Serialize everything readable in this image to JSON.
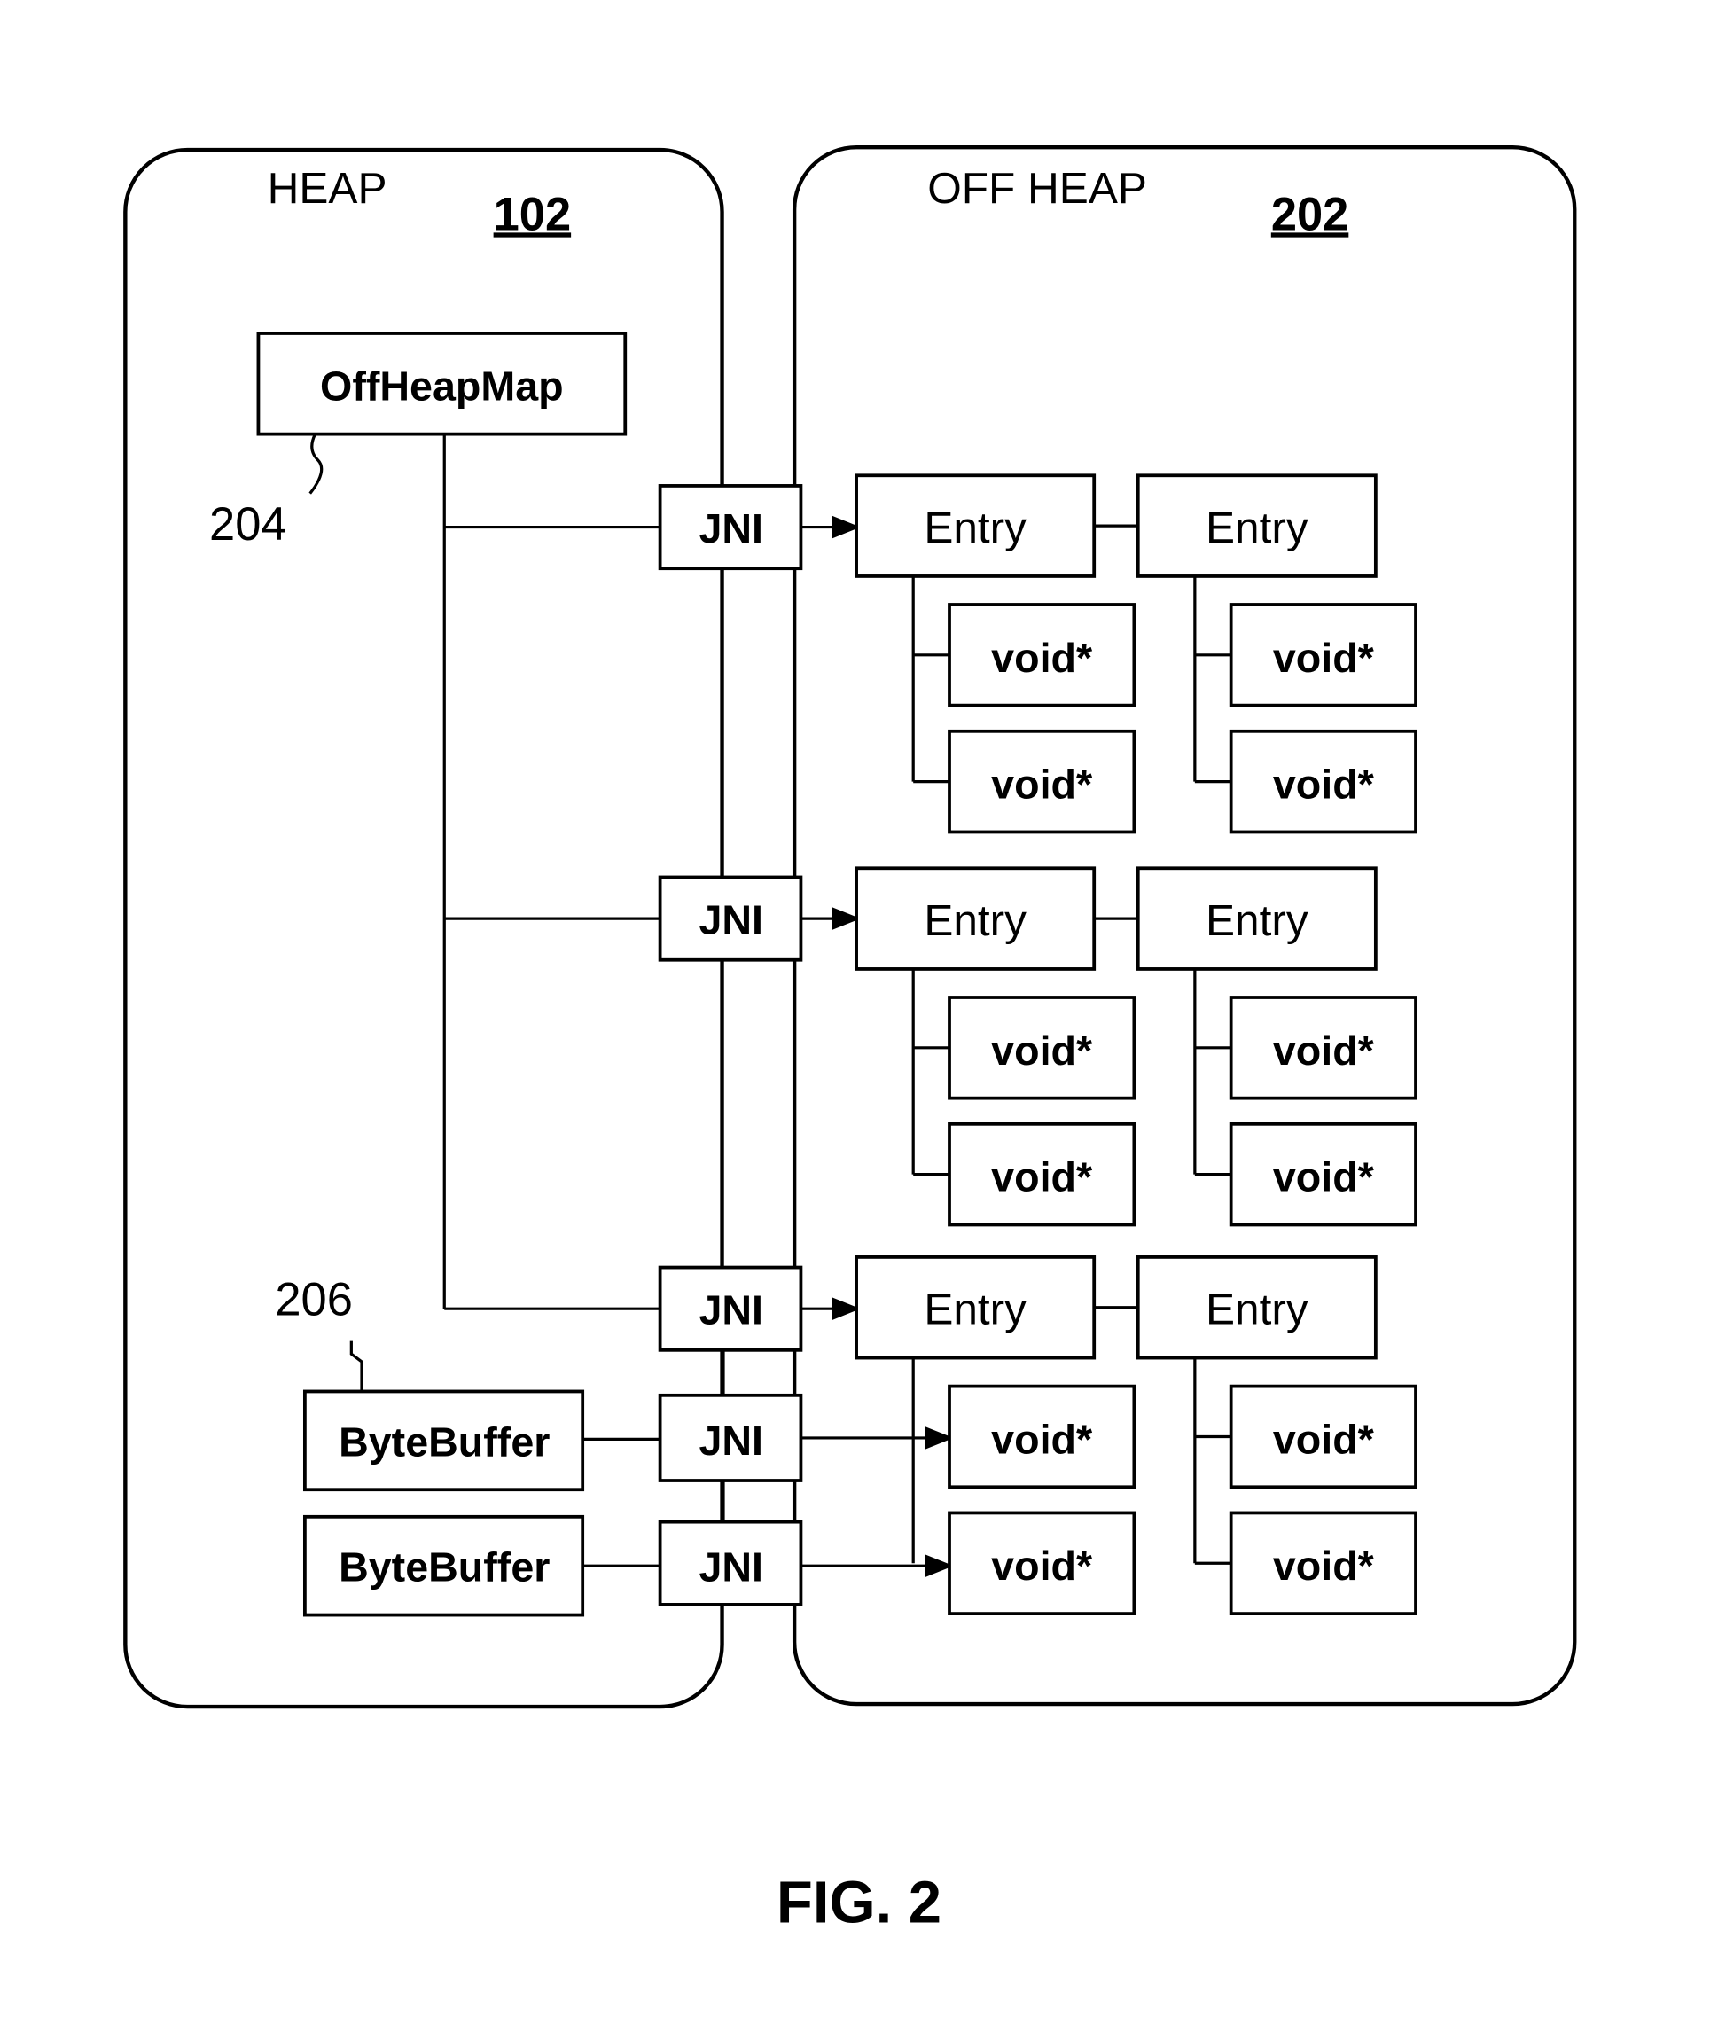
{
  "figure_label": "FIG. 2",
  "regions": {
    "heap": {
      "title": "HEAP",
      "ref": "102"
    },
    "off_heap": {
      "title": "OFF HEAP",
      "ref": "202"
    }
  },
  "heap_objects": {
    "offheapmap": {
      "label": "OffHeapMap",
      "ref": "204"
    },
    "bytebuffers": [
      {
        "label": "ByteBuffer",
        "ref": "206"
      },
      {
        "label": "ByteBuffer"
      }
    ]
  },
  "jni_label": "JNI",
  "jni_bridges": [
    "JNI",
    "JNI",
    "JNI",
    "JNI",
    "JNI"
  ],
  "entry_rows": [
    {
      "entries": [
        {
          "label": "Entry",
          "pointers": [
            "void*",
            "void*"
          ]
        },
        {
          "label": "Entry",
          "pointers": [
            "void*",
            "void*"
          ]
        }
      ]
    },
    {
      "entries": [
        {
          "label": "Entry",
          "pointers": [
            "void*",
            "void*"
          ]
        },
        {
          "label": "Entry",
          "pointers": [
            "void*",
            "void*"
          ]
        }
      ]
    },
    {
      "entries": [
        {
          "label": "Entry",
          "pointers": [
            "void*",
            "void*"
          ]
        },
        {
          "label": "Entry",
          "pointers": [
            "void*",
            "void*"
          ]
        }
      ]
    }
  ]
}
